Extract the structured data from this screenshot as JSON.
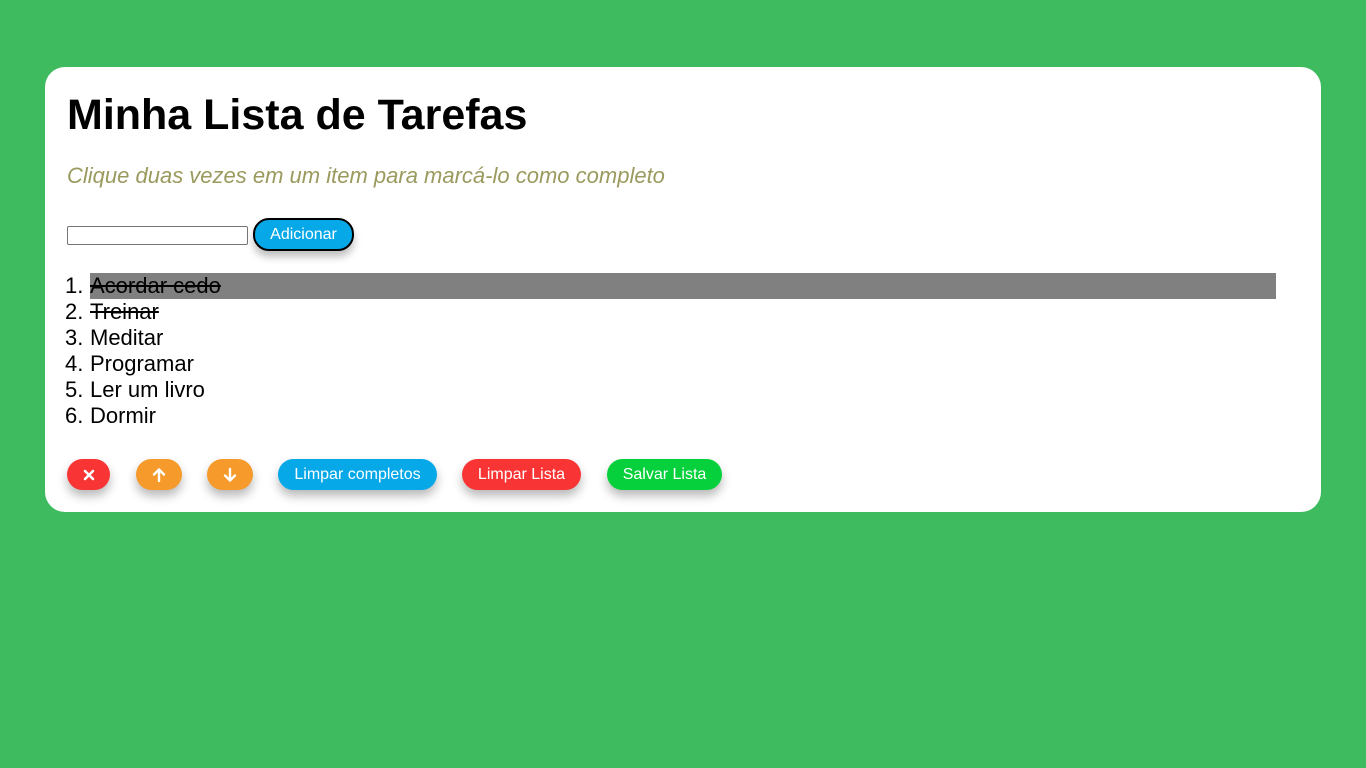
{
  "header": {
    "title": "Minha Lista de Tarefas",
    "subtitle": "Clique duas vezes em um item para marcá-lo como completo"
  },
  "add_form": {
    "input_value": "",
    "add_label": "Adicionar"
  },
  "tasks": [
    {
      "num": "1.",
      "text": "Acordar cedo",
      "completed": true,
      "selected": true
    },
    {
      "num": "2.",
      "text": "Treinar",
      "completed": true,
      "selected": false
    },
    {
      "num": "3.",
      "text": "Meditar",
      "completed": false,
      "selected": false
    },
    {
      "num": "4.",
      "text": "Programar",
      "completed": false,
      "selected": false
    },
    {
      "num": "5.",
      "text": "Ler um livro",
      "completed": false,
      "selected": false
    },
    {
      "num": "6.",
      "text": "Dormir",
      "completed": false,
      "selected": false
    }
  ],
  "actions": {
    "remove_icon": "x-icon",
    "move_up_icon": "arrow-up-icon",
    "move_down_icon": "arrow-down-icon",
    "clear_completed_label": "Limpar completos",
    "clear_list_label": "Limpar Lista",
    "save_list_label": "Salvar Lista"
  },
  "colors": {
    "page_background": "#3dbb5e",
    "accent_blue": "#06a8e8",
    "danger_red": "#f93434",
    "move_orange": "#f59a2b",
    "save_green": "#06d13c",
    "selected_gray": "#808080",
    "subtitle_olive": "#9a9a5e"
  }
}
